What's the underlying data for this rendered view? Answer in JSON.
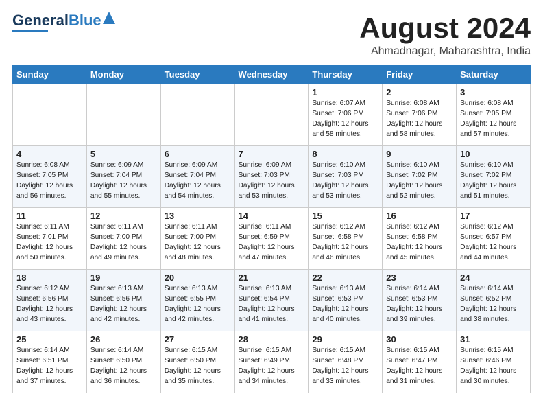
{
  "header": {
    "logo_line1": "General",
    "logo_line2": "Blue",
    "month": "August 2024",
    "location": "Ahmadnagar, Maharashtra, India"
  },
  "days_of_week": [
    "Sunday",
    "Monday",
    "Tuesday",
    "Wednesday",
    "Thursday",
    "Friday",
    "Saturday"
  ],
  "weeks": [
    [
      {
        "day": "",
        "detail": ""
      },
      {
        "day": "",
        "detail": ""
      },
      {
        "day": "",
        "detail": ""
      },
      {
        "day": "",
        "detail": ""
      },
      {
        "day": "1",
        "detail": "Sunrise: 6:07 AM\nSunset: 7:06 PM\nDaylight: 12 hours\nand 58 minutes."
      },
      {
        "day": "2",
        "detail": "Sunrise: 6:08 AM\nSunset: 7:06 PM\nDaylight: 12 hours\nand 58 minutes."
      },
      {
        "day": "3",
        "detail": "Sunrise: 6:08 AM\nSunset: 7:05 PM\nDaylight: 12 hours\nand 57 minutes."
      }
    ],
    [
      {
        "day": "4",
        "detail": "Sunrise: 6:08 AM\nSunset: 7:05 PM\nDaylight: 12 hours\nand 56 minutes."
      },
      {
        "day": "5",
        "detail": "Sunrise: 6:09 AM\nSunset: 7:04 PM\nDaylight: 12 hours\nand 55 minutes."
      },
      {
        "day": "6",
        "detail": "Sunrise: 6:09 AM\nSunset: 7:04 PM\nDaylight: 12 hours\nand 54 minutes."
      },
      {
        "day": "7",
        "detail": "Sunrise: 6:09 AM\nSunset: 7:03 PM\nDaylight: 12 hours\nand 53 minutes."
      },
      {
        "day": "8",
        "detail": "Sunrise: 6:10 AM\nSunset: 7:03 PM\nDaylight: 12 hours\nand 53 minutes."
      },
      {
        "day": "9",
        "detail": "Sunrise: 6:10 AM\nSunset: 7:02 PM\nDaylight: 12 hours\nand 52 minutes."
      },
      {
        "day": "10",
        "detail": "Sunrise: 6:10 AM\nSunset: 7:02 PM\nDaylight: 12 hours\nand 51 minutes."
      }
    ],
    [
      {
        "day": "11",
        "detail": "Sunrise: 6:11 AM\nSunset: 7:01 PM\nDaylight: 12 hours\nand 50 minutes."
      },
      {
        "day": "12",
        "detail": "Sunrise: 6:11 AM\nSunset: 7:00 PM\nDaylight: 12 hours\nand 49 minutes."
      },
      {
        "day": "13",
        "detail": "Sunrise: 6:11 AM\nSunset: 7:00 PM\nDaylight: 12 hours\nand 48 minutes."
      },
      {
        "day": "14",
        "detail": "Sunrise: 6:11 AM\nSunset: 6:59 PM\nDaylight: 12 hours\nand 47 minutes."
      },
      {
        "day": "15",
        "detail": "Sunrise: 6:12 AM\nSunset: 6:58 PM\nDaylight: 12 hours\nand 46 minutes."
      },
      {
        "day": "16",
        "detail": "Sunrise: 6:12 AM\nSunset: 6:58 PM\nDaylight: 12 hours\nand 45 minutes."
      },
      {
        "day": "17",
        "detail": "Sunrise: 6:12 AM\nSunset: 6:57 PM\nDaylight: 12 hours\nand 44 minutes."
      }
    ],
    [
      {
        "day": "18",
        "detail": "Sunrise: 6:12 AM\nSunset: 6:56 PM\nDaylight: 12 hours\nand 43 minutes."
      },
      {
        "day": "19",
        "detail": "Sunrise: 6:13 AM\nSunset: 6:56 PM\nDaylight: 12 hours\nand 42 minutes."
      },
      {
        "day": "20",
        "detail": "Sunrise: 6:13 AM\nSunset: 6:55 PM\nDaylight: 12 hours\nand 42 minutes."
      },
      {
        "day": "21",
        "detail": "Sunrise: 6:13 AM\nSunset: 6:54 PM\nDaylight: 12 hours\nand 41 minutes."
      },
      {
        "day": "22",
        "detail": "Sunrise: 6:13 AM\nSunset: 6:53 PM\nDaylight: 12 hours\nand 40 minutes."
      },
      {
        "day": "23",
        "detail": "Sunrise: 6:14 AM\nSunset: 6:53 PM\nDaylight: 12 hours\nand 39 minutes."
      },
      {
        "day": "24",
        "detail": "Sunrise: 6:14 AM\nSunset: 6:52 PM\nDaylight: 12 hours\nand 38 minutes."
      }
    ],
    [
      {
        "day": "25",
        "detail": "Sunrise: 6:14 AM\nSunset: 6:51 PM\nDaylight: 12 hours\nand 37 minutes."
      },
      {
        "day": "26",
        "detail": "Sunrise: 6:14 AM\nSunset: 6:50 PM\nDaylight: 12 hours\nand 36 minutes."
      },
      {
        "day": "27",
        "detail": "Sunrise: 6:15 AM\nSunset: 6:50 PM\nDaylight: 12 hours\nand 35 minutes."
      },
      {
        "day": "28",
        "detail": "Sunrise: 6:15 AM\nSunset: 6:49 PM\nDaylight: 12 hours\nand 34 minutes."
      },
      {
        "day": "29",
        "detail": "Sunrise: 6:15 AM\nSunset: 6:48 PM\nDaylight: 12 hours\nand 33 minutes."
      },
      {
        "day": "30",
        "detail": "Sunrise: 6:15 AM\nSunset: 6:47 PM\nDaylight: 12 hours\nand 31 minutes."
      },
      {
        "day": "31",
        "detail": "Sunrise: 6:15 AM\nSunset: 6:46 PM\nDaylight: 12 hours\nand 30 minutes."
      }
    ]
  ]
}
